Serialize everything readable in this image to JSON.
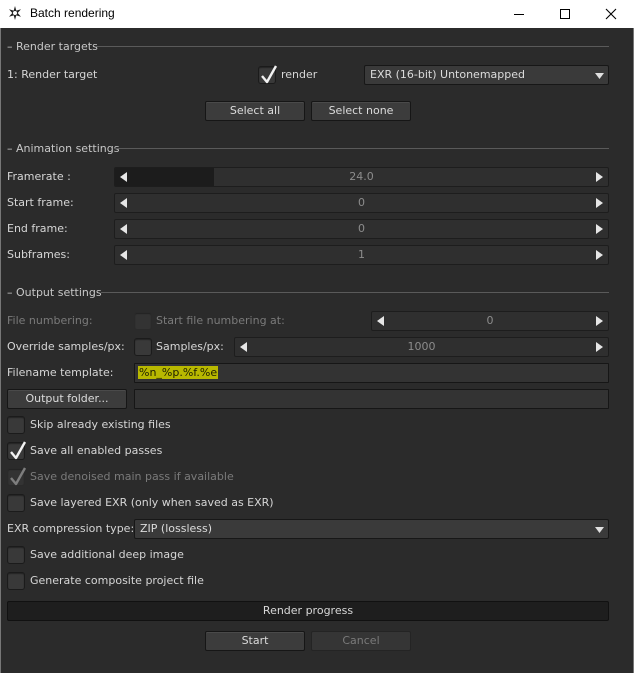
{
  "window": {
    "title": "Batch rendering",
    "icon": "octane-star-icon",
    "controls": [
      "minimize-icon",
      "maximize-icon",
      "close-icon"
    ]
  },
  "render_targets": {
    "section_title": "Render targets",
    "target_label": "1: Render target",
    "render_checkbox_label": "render",
    "render_checked": true,
    "format_value": "EXR (16-bit) Untonemapped",
    "select_all_label": "Select all",
    "select_none_label": "Select none"
  },
  "animation": {
    "section_title": "Animation settings",
    "framerate_label": "Framerate :",
    "framerate_value": "24.0",
    "framerate_fill_fraction": 0.2,
    "start_label": "Start frame:",
    "start_value": "0",
    "end_label": "End frame:",
    "end_value": "0",
    "subframes_label": "Subframes:",
    "subframes_value": "1"
  },
  "output": {
    "section_title": "Output settings",
    "file_numbering_label": "File numbering:",
    "start_numbering_label": "Start file numbering at:",
    "start_numbering_value": "0",
    "override_label": "Override samples/px:",
    "samples_label": "Samples/px:",
    "samples_value": "1000",
    "filename_template_label": "Filename template:",
    "filename_template_value": "%n_%p.%f.%e",
    "output_folder_label": "Output folder...",
    "output_folder_value": "",
    "skip_existing_label": "Skip already existing files",
    "skip_existing_checked": false,
    "save_passes_label": "Save all enabled passes",
    "save_passes_checked": true,
    "save_denoised_label": "Save denoised main pass if available",
    "save_denoised_checked": true,
    "save_layered_label": "Save layered EXR (only when saved as EXR)",
    "save_layered_checked": false,
    "exr_compression_label": "EXR compression type:",
    "exr_compression_value": "ZIP (lossless)",
    "deep_image_label": "Save additional deep image",
    "deep_image_checked": false,
    "composite_label": "Generate composite project file",
    "composite_checked": false
  },
  "footer": {
    "progress_label": "Render progress",
    "start_label": "Start",
    "cancel_label": "Cancel"
  }
}
